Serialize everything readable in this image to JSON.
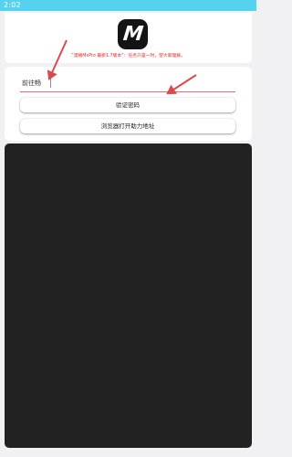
{
  "status_bar": {
    "time": "2:02",
    "color": "#55d2f0"
  },
  "header": {
    "logo_letter": "M",
    "notice": "“漫播MxPro 最新1.7版本”：任务只是一时，望大家理解。",
    "notice_color": "#e1272a"
  },
  "form": {
    "password_placeholder": "前往畅",
    "verify_button": "验证密码",
    "browser_button": "浏览器打开助力地址",
    "underline_color": "#d9707f"
  },
  "annotations": {
    "arrow_color": "#d94a4f"
  },
  "content": {
    "panel_color": "#222222"
  }
}
